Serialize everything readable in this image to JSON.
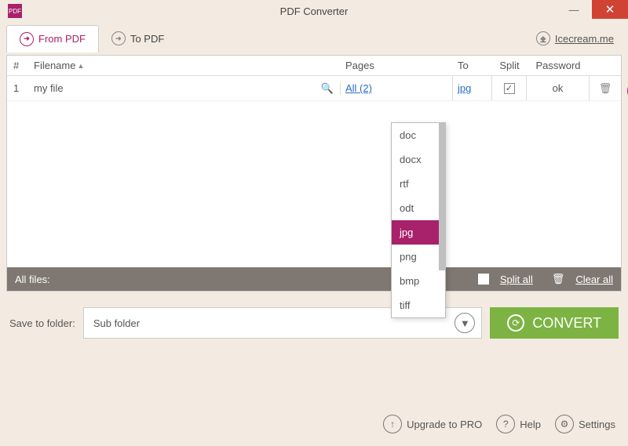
{
  "window": {
    "title": "PDF Converter"
  },
  "tabs": {
    "from": "From PDF",
    "to": "To PDF",
    "site": "Icecream.me"
  },
  "headers": {
    "num": "#",
    "filename": "Filename",
    "pages": "Pages",
    "to": "To",
    "split": "Split",
    "password": "Password"
  },
  "row": {
    "num": "1",
    "filename": "my file",
    "pages_link": "All (2)",
    "to_value": "jpg",
    "split_checked": "✓",
    "password": "ok"
  },
  "dropdown": {
    "items": [
      "doc",
      "docx",
      "rtf",
      "odt",
      "jpg",
      "png",
      "bmp",
      "tiff"
    ],
    "selected": "jpg"
  },
  "allfiles": {
    "label": "All files:",
    "split_all": "Split all",
    "clear_all": "Clear all"
  },
  "save": {
    "label": "Save to folder:",
    "value": "Sub folder"
  },
  "convert": "CONVERT",
  "bottom": {
    "upgrade": "Upgrade to PRO",
    "help": "Help",
    "settings": "Settings"
  }
}
